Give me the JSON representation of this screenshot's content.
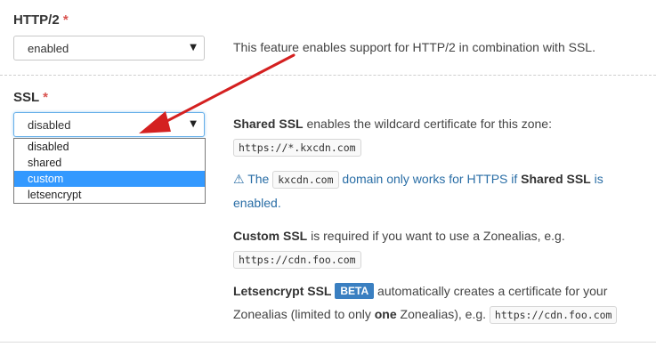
{
  "http2": {
    "label": "HTTP/2",
    "required_mark": "*",
    "selected": "enabled",
    "help": "This feature enables support for HTTP/2 in combination with SSL."
  },
  "ssl": {
    "label": "SSL",
    "required_mark": "*",
    "selected": "disabled",
    "options": [
      "disabled",
      "shared",
      "custom",
      "letsencrypt"
    ],
    "highlighted_option": "custom"
  },
  "help": {
    "shared_title": "Shared SSL",
    "shared_text": " enables the wildcard certificate for this zone:",
    "shared_code": "https://*.kxcdn.com",
    "warn_the": "The",
    "warn_code": "kxcdn.com",
    "warn_text": "domain only works for HTTPS if",
    "warn_shared": "Shared SSL",
    "warn_is": "is",
    "warn_enabled": "enabled.",
    "custom_title": "Custom SSL",
    "custom_text": " is required if you want to use a Zonealias, e.g.",
    "custom_code": "https://cdn.foo.com",
    "le_title": "Letsencrypt SSL",
    "le_badge": "BETA",
    "le_text": "automatically creates a certificate for your",
    "le_text2a": "Zonealias (limited to only ",
    "le_one": "one",
    "le_text2b": " Zonealias), e.g.",
    "le_code": "https://cdn.foo.com"
  },
  "colors": {
    "required": "#d9534f",
    "arrow": "#d42020",
    "highlight": "#3399ff",
    "link": "#2a6ea6"
  },
  "icons": {
    "caret": "triangle-down",
    "warning": "exclamation-triangle"
  }
}
